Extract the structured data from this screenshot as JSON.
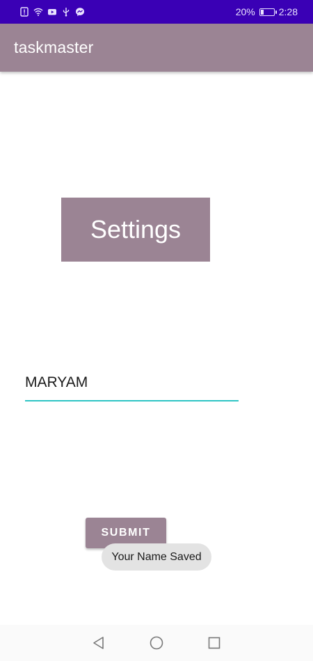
{
  "status_bar": {
    "battery_percent": "20%",
    "battery_level": 0.2,
    "time": "2:28",
    "left_icons": [
      "alert-icon",
      "wifi-icon",
      "youtube-icon",
      "usb-icon",
      "messenger-icon"
    ],
    "background_color": "#3a00b5"
  },
  "app_bar": {
    "title": "taskmaster",
    "background_color": "#9b8494"
  },
  "settings": {
    "label": "Settings"
  },
  "name_input": {
    "value": "MARYAM",
    "underline_color": "#2ec4c4"
  },
  "submit": {
    "label": "SUBMIT"
  },
  "toast": {
    "message": "Your Name Saved"
  },
  "nav_bar": {
    "buttons": [
      "back-icon",
      "home-icon",
      "recents-icon"
    ]
  }
}
